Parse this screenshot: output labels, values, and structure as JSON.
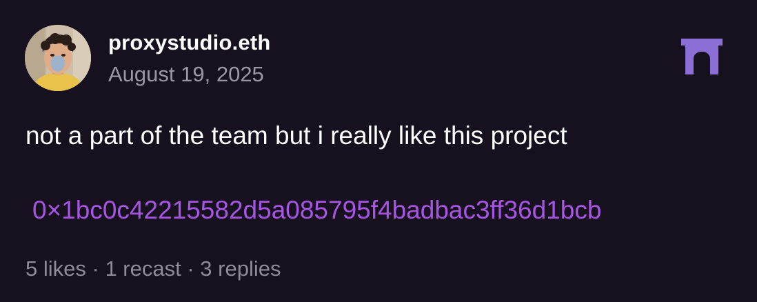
{
  "post": {
    "author": {
      "username": "proxystudio.eth",
      "avatar_icon": "user-avatar-photo"
    },
    "date": "August 19, 2025",
    "channel_icon": "archway-icon",
    "text": "not a part of the team but i really like this project",
    "address": "0×1bc0c42215582d5a085795f4badbac3ff36d1bcb",
    "stats": {
      "likes": "5 likes",
      "recasts": "1 recast",
      "replies": "3 replies",
      "separator": " · "
    }
  },
  "colors": {
    "background": "#17101f",
    "text_primary": "#ffffff",
    "text_secondary": "#9b98a3",
    "address_accent": "#a855e6",
    "channel_icon": "#8b6fd6"
  }
}
